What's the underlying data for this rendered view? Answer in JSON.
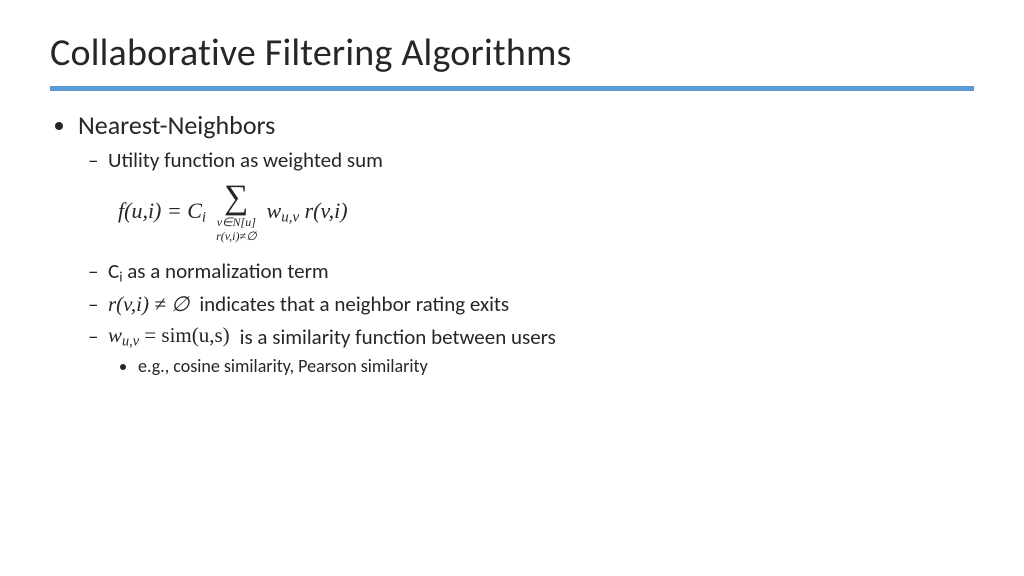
{
  "title": "Collaborative Filtering Algorithms",
  "bullets": {
    "b1": "Nearest-Neighbors",
    "b1_1": "Utility function as weighted sum",
    "formula": {
      "lhs": "f(u,i) = C",
      "lhs_sub": "i",
      "sum_sub1": "v∈N[u]",
      "sum_sub2": "r(v,i)≠∅",
      "rhs_w": "w",
      "rhs_w_sub": "u,v",
      "rhs_r": " r(v,i)"
    },
    "b1_2_pre": "C",
    "b1_2_sub": "i",
    "b1_2_post": " as a normalization term",
    "b1_3_math": "r(v,i) ≠ ∅",
    "b1_3_text": "indicates that a neighbor rating exits",
    "b1_4_math_w": "w",
    "b1_4_math_sub": "u,v",
    "b1_4_math_eq": " = sim(u,s)",
    "b1_4_text": "is a similarity function between users",
    "b1_4_1": "e.g., cosine similarity, Pearson similarity"
  }
}
